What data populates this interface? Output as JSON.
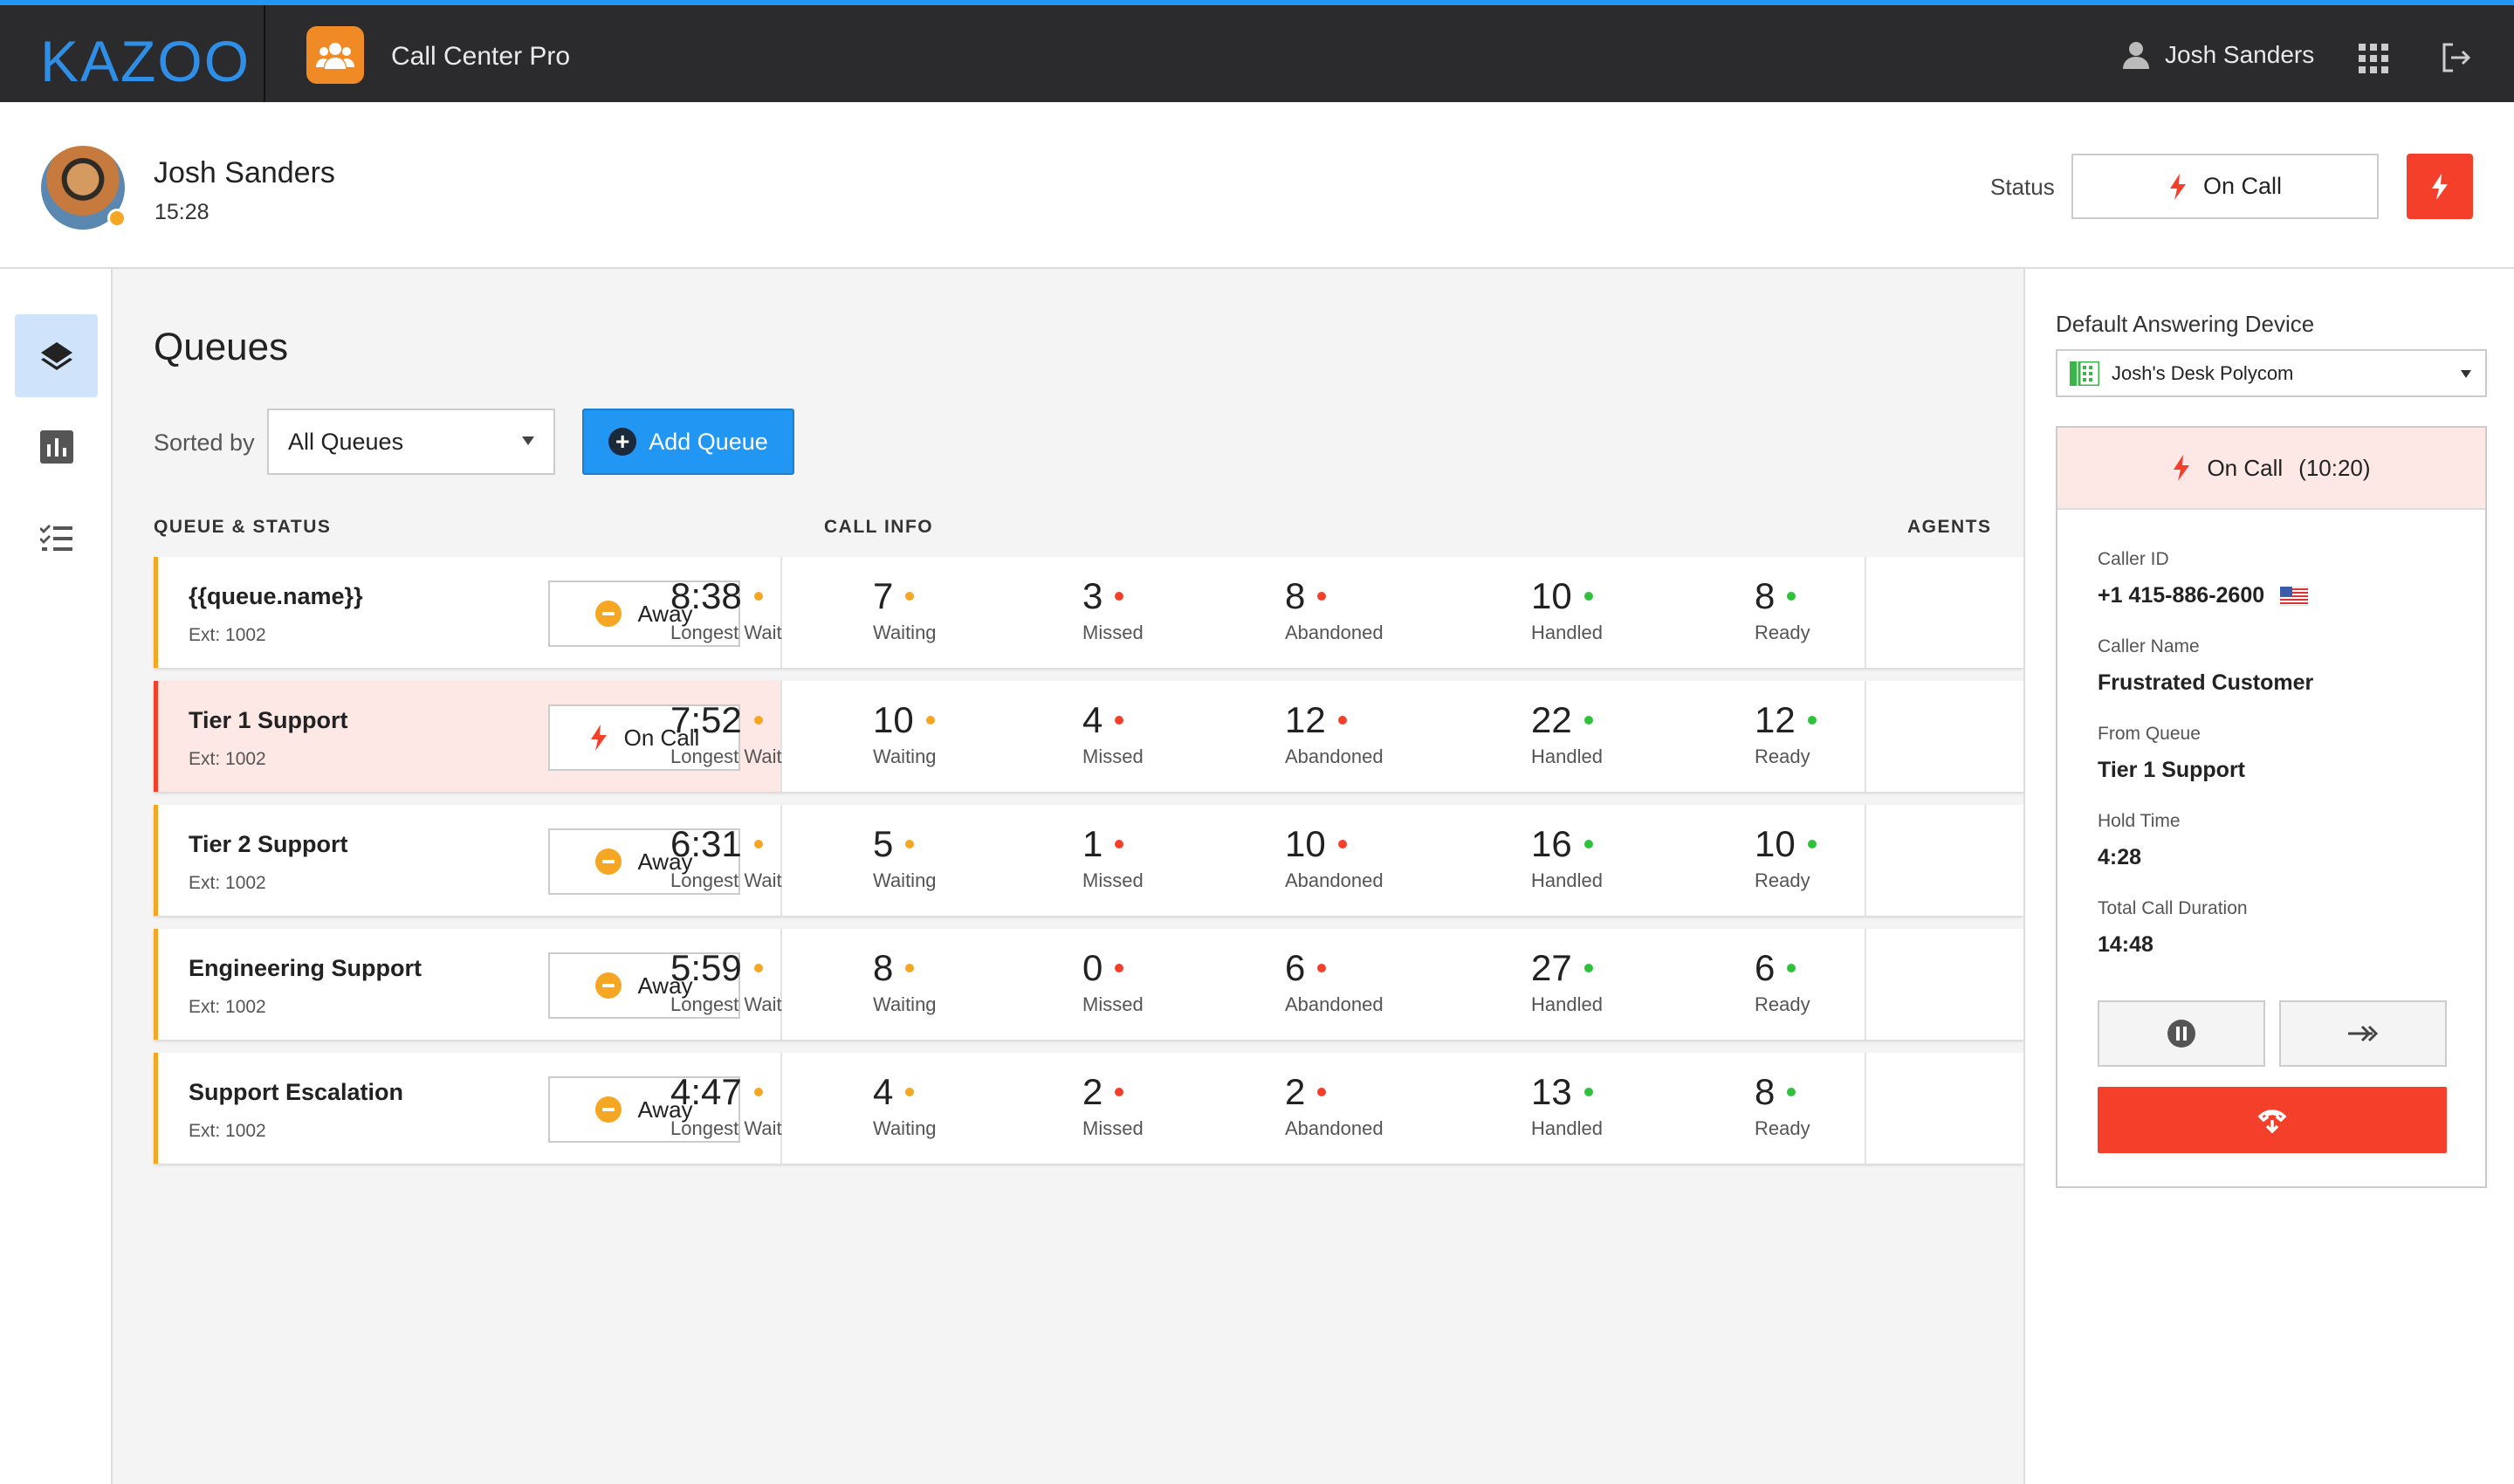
{
  "app": {
    "logo": "KAZOO",
    "title": "Call Center Pro",
    "user": "Josh Sanders"
  },
  "profile": {
    "name": "Josh Sanders",
    "time": "15:28",
    "status_label": "Status",
    "status_value": "On Call"
  },
  "main": {
    "title": "Queues",
    "sorted_by_label": "Sorted by",
    "sort_value": "All Queues",
    "add_button": "Add Queue",
    "columns": {
      "queue": "QUEUE & STATUS",
      "call_info": "CALL INFO",
      "agents": "AGENTS"
    },
    "metric_labels": {
      "wait": "Longest Wait",
      "waiting": "Waiting",
      "missed": "Missed",
      "abandoned": "Abandoned",
      "handled": "Handled",
      "ready": "Ready"
    },
    "queues": [
      {
        "name": "{{queue.name}}",
        "ext": "Ext: 1002",
        "status": "Away",
        "wait": "8:38",
        "waiting": "7",
        "missed": "3",
        "abandoned": "8",
        "handled": "10",
        "ready": "8"
      },
      {
        "name": "Tier 1 Support",
        "ext": "Ext: 1002",
        "status": "On Call",
        "wait": "7:52",
        "waiting": "10",
        "missed": "4",
        "abandoned": "12",
        "handled": "22",
        "ready": "12"
      },
      {
        "name": "Tier 2 Support",
        "ext": "Ext: 1002",
        "status": "Away",
        "wait": "6:31",
        "waiting": "5",
        "missed": "1",
        "abandoned": "10",
        "handled": "16",
        "ready": "10"
      },
      {
        "name": "Engineering Support",
        "ext": "Ext: 1002",
        "status": "Away",
        "wait": "5:59",
        "waiting": "8",
        "missed": "0",
        "abandoned": "6",
        "handled": "27",
        "ready": "6"
      },
      {
        "name": "Support Escalation",
        "ext": "Ext: 1002",
        "status": "Away",
        "wait": "4:47",
        "waiting": "4",
        "missed": "2",
        "abandoned": "2",
        "handled": "13",
        "ready": "8"
      }
    ]
  },
  "right_panel": {
    "device_label": "Default Answering Device",
    "device_value": "Josh's Desk Polycom",
    "call_status": "On Call",
    "call_duration": "(10:20)",
    "caller_id_label": "Caller ID",
    "caller_id": "+1 415-886-2600",
    "caller_name_label": "Caller Name",
    "caller_name": "Frustrated Customer",
    "from_queue_label": "From Queue",
    "from_queue": "Tier 1 Support",
    "hold_time_label": "Hold Time",
    "hold_time": "4:28",
    "total_duration_label": "Total Call Duration",
    "total_duration": "14:48"
  },
  "colors": {
    "accent_blue": "#2196f3",
    "alert_red": "#f4402a",
    "away_orange": "#f5a623",
    "ok_green": "#2ec23c",
    "topbar": "#2b2b2e"
  },
  "icons": [
    "user-icon",
    "apps-grid-icon",
    "logout-icon",
    "layers-icon",
    "bar-chart-icon",
    "checklist-icon",
    "lightning-icon",
    "plus-circle-icon",
    "away-icon",
    "phone-device-icon",
    "us-flag-icon",
    "pause-icon",
    "forward-icon",
    "hangup-icon"
  ]
}
